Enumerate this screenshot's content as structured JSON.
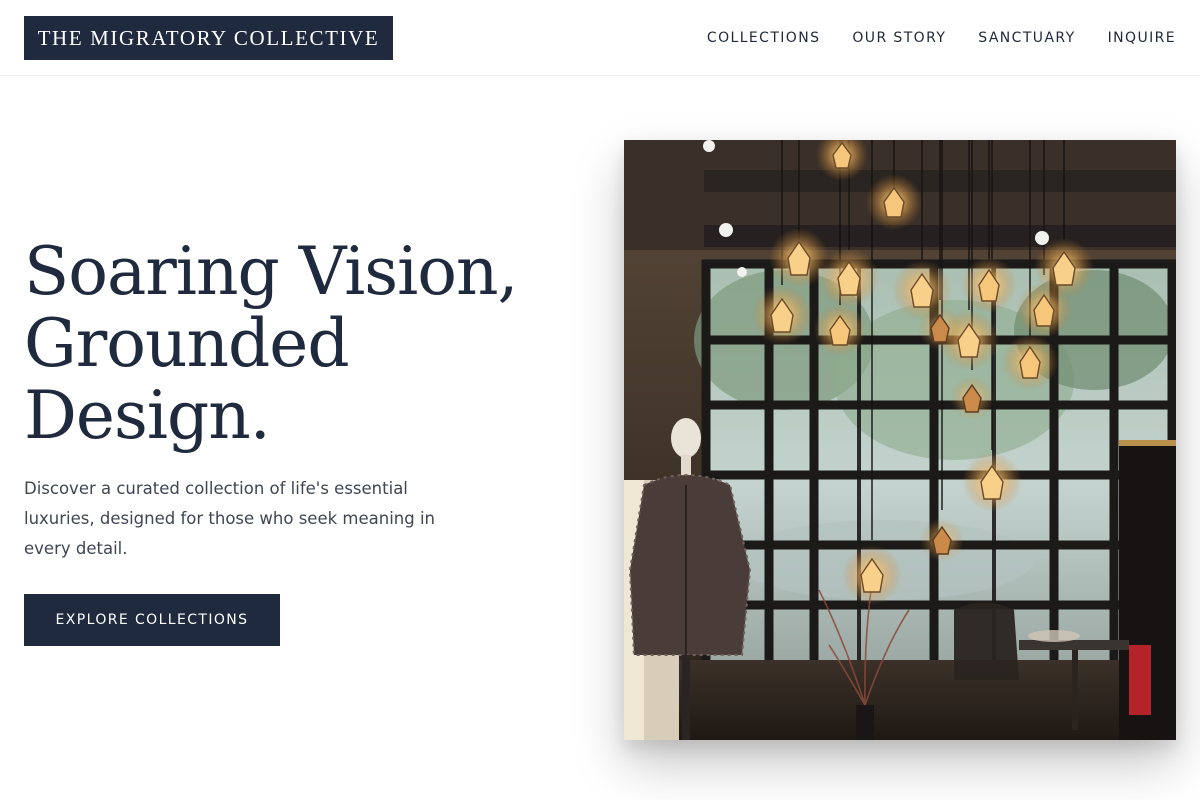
{
  "header": {
    "logo": "THE MIGRATORY COLLECTIVE",
    "nav": [
      {
        "label": "COLLECTIONS"
      },
      {
        "label": "OUR STORY"
      },
      {
        "label": "SANCTUARY"
      },
      {
        "label": "INQUIRE"
      }
    ]
  },
  "hero": {
    "title_lines": [
      "Soaring Vision,",
      "Grounded",
      "Design."
    ],
    "description": "Discover a curated collection of life's essential luxuries, designed for those who seek meaning in every detail.",
    "cta_label": "EXPLORE COLLECTIONS",
    "image_alt": "Boutique interior with hanging Edison bulbs, mannequin in tweed coat and tall steel-framed windows"
  },
  "colors": {
    "brand_navy": "#1f2a3e",
    "text_body": "#3f4652",
    "background": "#ffffff"
  }
}
